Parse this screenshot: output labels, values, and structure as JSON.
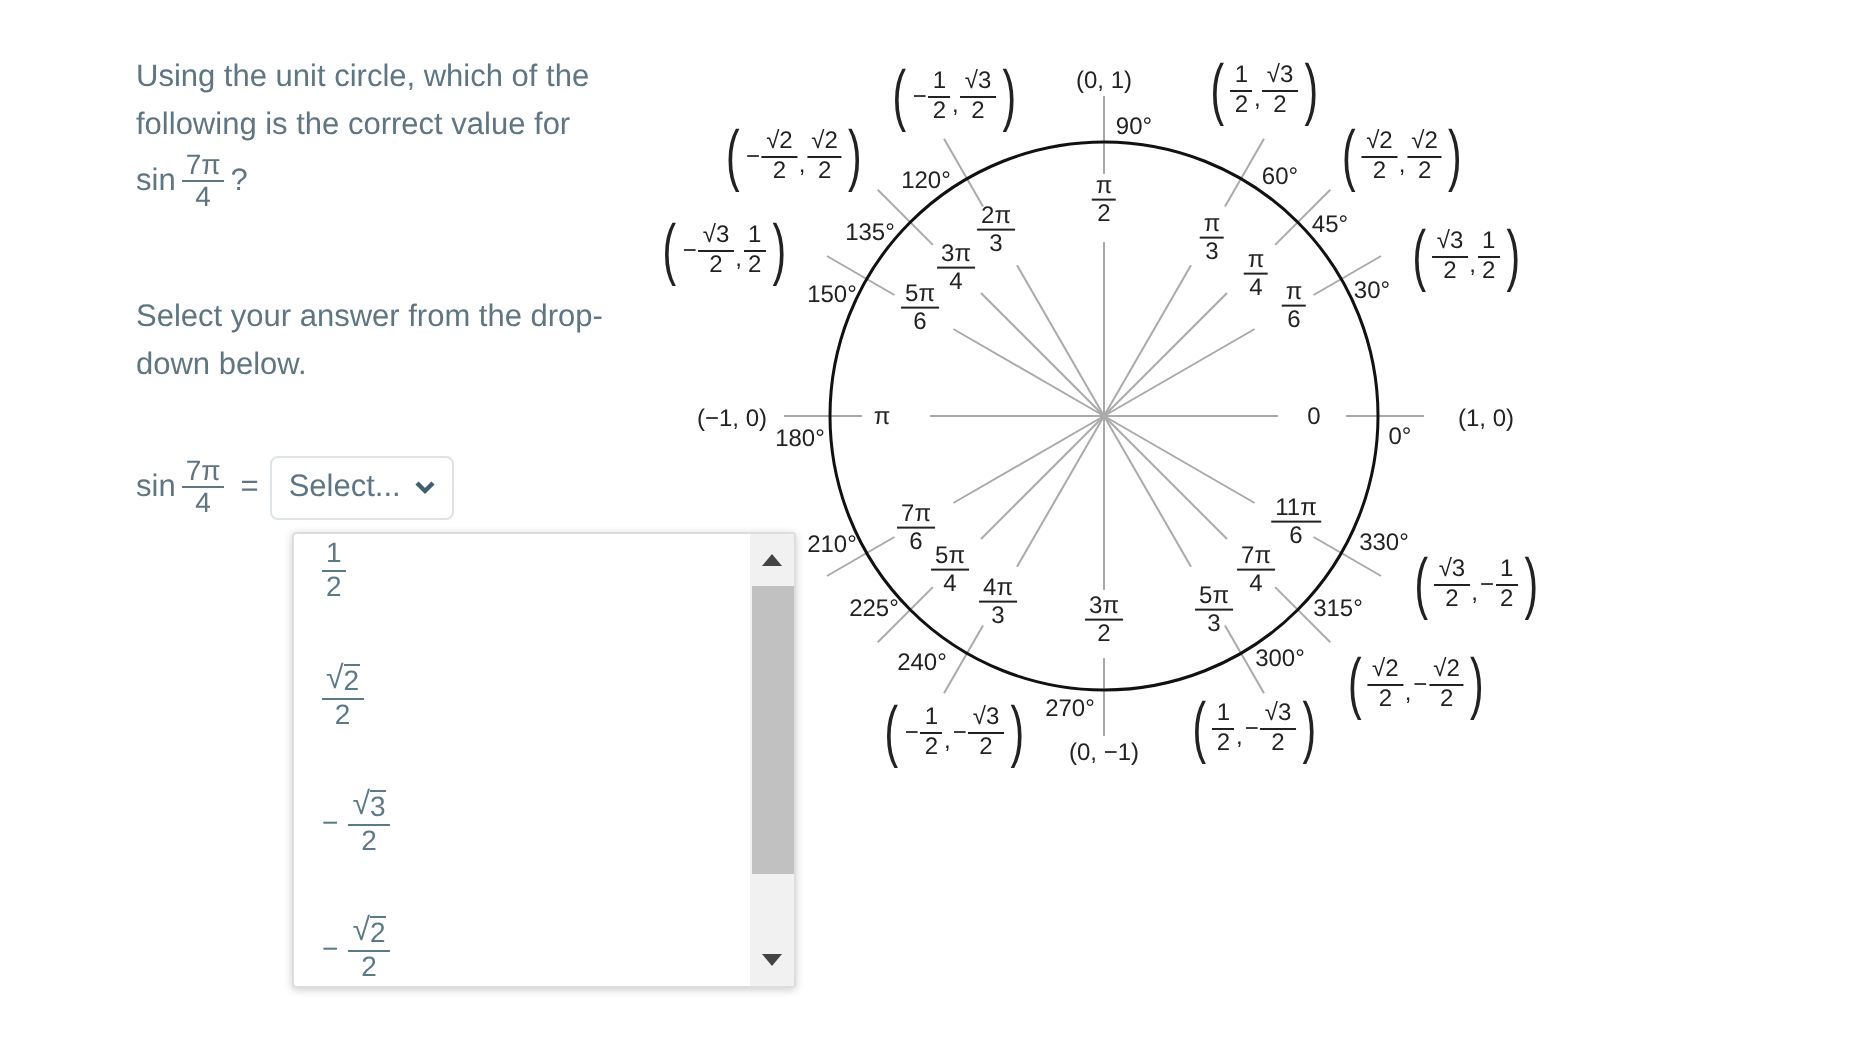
{
  "question": {
    "text": "Using the unit circle, which of the following is the correct value for",
    "expr": {
      "fn": "sin",
      "num": "7π",
      "den": "4"
    },
    "end": "?"
  },
  "instruction": "Select your answer from the drop-down below.",
  "answer": {
    "expr": {
      "fn": "sin",
      "num": "7π",
      "den": "4"
    },
    "equals": "=",
    "dropdown": {
      "placeholder": "Select...",
      "expanded": true,
      "options": [
        {
          "num": "1",
          "den": "2",
          "selected": false
        },
        {
          "radical": "√",
          "radicand": "2",
          "den": "2",
          "selected": false
        },
        {
          "sign": "−",
          "radical": "√",
          "radicand": "3",
          "den": "2",
          "selected": false
        },
        {
          "sign": "−",
          "radical": "√",
          "radicand": "2",
          "den": "2",
          "selected": false
        }
      ]
    }
  },
  "unit_circle": {
    "angles": [
      {
        "degrees": "120°",
        "radians": {
          "num": "2π",
          "den": "3"
        },
        "point": {
          "kind": "pair",
          "open": "(",
          "x": {
            "sign": "−",
            "num": "1",
            "den": "2"
          },
          "sep": ",",
          "y": {
            "num": "√3",
            "den": "2"
          },
          "close": ")"
        }
      },
      {
        "degrees": "90°",
        "radians": {
          "num": "π",
          "den": "2"
        },
        "point": {
          "kind": "plain",
          "text": "(0, 1)"
        }
      },
      {
        "degrees": "60°",
        "radians": {
          "num": "π",
          "den": "3"
        },
        "point": {
          "kind": "pair",
          "open": "(",
          "x": {
            "num": "1",
            "den": "2"
          },
          "sep": ",",
          "y": {
            "num": "√3",
            "den": "2"
          },
          "close": ")"
        }
      },
      {
        "degrees": "135°",
        "radians": {
          "num": "3π",
          "den": "4"
        },
        "point": {
          "kind": "pair",
          "open": "(",
          "x": {
            "sign": "−",
            "num": "√2",
            "den": "2"
          },
          "sep": ",",
          "y": {
            "num": "√2",
            "den": "2"
          },
          "close": ")"
        }
      },
      {
        "degrees": "45°",
        "radians": {
          "num": "π",
          "den": "4"
        },
        "point": {
          "kind": "pair",
          "open": "(",
          "x": {
            "num": "√2",
            "den": "2"
          },
          "sep": ",",
          "y": {
            "num": "√2",
            "den": "2"
          },
          "close": ")"
        }
      },
      {
        "degrees": "150°",
        "radians": {
          "num": "5π",
          "den": "6"
        },
        "point": {
          "kind": "pair",
          "open": "(",
          "x": {
            "sign": "−",
            "num": "√3",
            "den": "2"
          },
          "sep": ",",
          "y": {
            "num": "1",
            "den": "2"
          },
          "close": ")"
        }
      },
      {
        "degrees": "30°",
        "radians": {
          "num": "π",
          "den": "6"
        },
        "point": {
          "kind": "pair",
          "open": "(",
          "x": {
            "num": "√3",
            "den": "2"
          },
          "sep": ",",
          "y": {
            "num": "1",
            "den": "2"
          },
          "close": ")"
        }
      },
      {
        "degrees": "180°",
        "radians": {
          "text": "π"
        },
        "point": {
          "kind": "plain",
          "text": "(−1, 0)"
        }
      },
      {
        "degrees": "0°",
        "radians": {
          "text": "0"
        },
        "point": {
          "kind": "plain",
          "text": "(1, 0)"
        }
      },
      {
        "degrees": "210°",
        "radians": {
          "num": "7π",
          "den": "6"
        }
      },
      {
        "degrees": "225°",
        "radians": {
          "num": "5π",
          "den": "4"
        }
      },
      {
        "degrees": "240°",
        "radians": {
          "num": "4π",
          "den": "3"
        },
        "point": {
          "kind": "pair",
          "open": "(",
          "x": {
            "sign": "−",
            "num": "1",
            "den": "2"
          },
          "sep": ",",
          "y": {
            "sign": "−",
            "num": "√3",
            "den": "2"
          },
          "close": ")"
        }
      },
      {
        "degrees": "270°",
        "radians": {
          "num": "3π",
          "den": "2"
        },
        "point": {
          "kind": "plain",
          "text": "(0, −1)"
        }
      },
      {
        "degrees": "300°",
        "radians": {
          "num": "5π",
          "den": "3"
        },
        "point": {
          "kind": "pair",
          "open": "(",
          "x": {
            "num": "1",
            "den": "2"
          },
          "sep": ",",
          "y": {
            "sign": "−",
            "num": "√3",
            "den": "2"
          },
          "close": ")"
        }
      },
      {
        "degrees": "315°",
        "radians": {
          "num": "7π",
          "den": "4"
        },
        "point": {
          "kind": "pair",
          "open": "(",
          "x": {
            "num": "√2",
            "den": "2"
          },
          "sep": ",",
          "y": {
            "sign": "−",
            "num": "√2",
            "den": "2"
          },
          "close": ")"
        }
      },
      {
        "degrees": "330°",
        "radians": {
          "num": "11π",
          "den": "6"
        },
        "point": {
          "kind": "pair",
          "open": "(",
          "x": {
            "num": "√3",
            "den": "2"
          },
          "sep": ",",
          "y": {
            "sign": "−",
            "num": "1",
            "den": "2"
          },
          "close": ")"
        }
      }
    ]
  }
}
